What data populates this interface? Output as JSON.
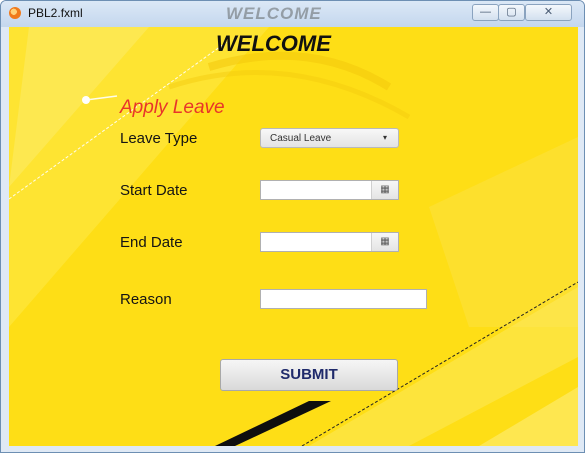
{
  "window": {
    "title": "PBL2.fxml",
    "ghost_title": "WELCOME",
    "controls": {
      "minimize": "—",
      "maximize": "▢",
      "close": "✕"
    }
  },
  "form": {
    "heading": "WELCOME",
    "subheading": "Apply Leave",
    "leave_type_label": "Leave Type",
    "leave_type_value": "Casual Leave",
    "start_date_label": "Start Date",
    "start_date_value": "",
    "end_date_label": "End Date",
    "end_date_value": "",
    "reason_label": "Reason",
    "reason_value": "",
    "submit_label": "SUBMIT"
  },
  "icons": {
    "dropdown": "▾",
    "calendar": "▦"
  },
  "colors": {
    "background": "#fede16",
    "subheading": "#e8352a",
    "submit_text": "#1f2a6b"
  }
}
